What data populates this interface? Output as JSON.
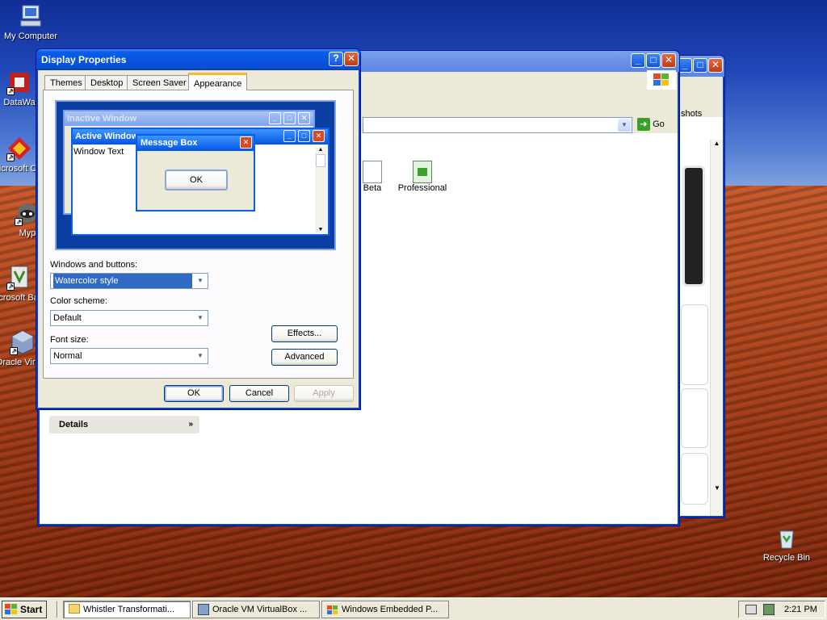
{
  "desktop": {
    "icons": [
      {
        "label": "My Computer"
      },
      {
        "label": "DataWa"
      },
      {
        "label": "Microsoft C++"
      },
      {
        "label": "Myp"
      },
      {
        "label": "Microsoft Basic"
      },
      {
        "label": "Oracle Virtual"
      },
      {
        "label": "Recycle Bin"
      }
    ]
  },
  "back_window": {
    "toolbar_fragment": "shots",
    "go_label": "Go",
    "files": [
      {
        "label": "Beta"
      },
      {
        "label": "Professional"
      }
    ],
    "details_label": "Details"
  },
  "display_properties": {
    "title": "Display Properties",
    "help_btn": "?",
    "close_btn": "✕",
    "tabs": [
      "Themes",
      "Desktop",
      "Screen Saver",
      "Appearance"
    ],
    "active_tab": "Appearance",
    "preview": {
      "inactive_title": "Inactive Window",
      "active_title": "Active Window",
      "window_text": "Window Text",
      "message_title": "Message Box",
      "message_ok": "OK"
    },
    "windows_buttons_label": "Windows and buttons:",
    "windows_buttons_value": "Watercolor style",
    "color_scheme_label": "Color scheme:",
    "color_scheme_value": "Default",
    "font_size_label": "Font size:",
    "font_size_value": "Normal",
    "effects_btn": "Effects...",
    "advanced_btn": "Advanced",
    "ok_btn": "OK",
    "cancel_btn": "Cancel",
    "apply_btn": "Apply"
  },
  "taskbar": {
    "start_label": "Start",
    "tasks": [
      {
        "label": "Whistler Transformati..."
      },
      {
        "label": "Oracle VM VirtualBox ..."
      },
      {
        "label": "Windows Embedded P..."
      }
    ],
    "clock": "2:21 PM"
  },
  "colors": {
    "title_active": "#0554e0",
    "dialog_bg": "#ece9d8",
    "preview_bg": "#0a3ea0"
  }
}
